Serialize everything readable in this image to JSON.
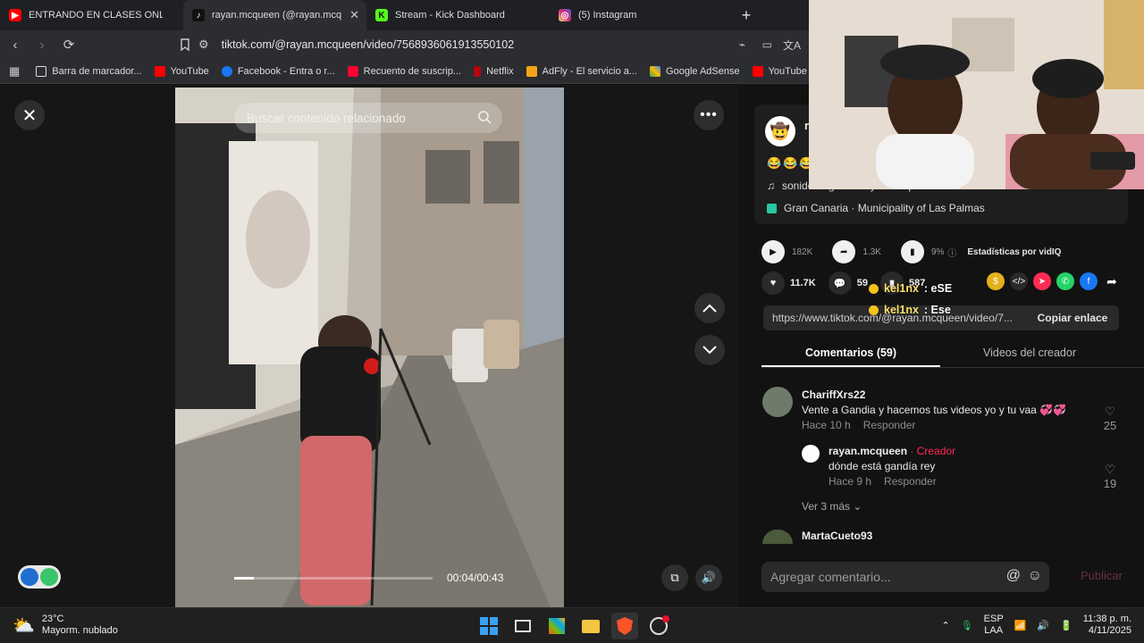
{
  "tabs": [
    {
      "label": "ENTRANDO EN CLASES ONLINE DE I",
      "icon": "youtube-icon",
      "color": "#ff0000",
      "active": false
    },
    {
      "label": "rayan.mcqueen (@rayan.mcq",
      "icon": "tiktok-icon",
      "color": "#111111",
      "active": true
    },
    {
      "label": "Stream - Kick Dashboard",
      "icon": "kick-icon",
      "color": "#53fc18",
      "active": false
    },
    {
      "label": "(5) Instagram",
      "icon": "instagram-icon",
      "color": "#d62976",
      "active": false
    }
  ],
  "address": {
    "url": "tiktok.com/@rayan.mcqueen/video/7568936061913550102"
  },
  "bookmarks": [
    {
      "label": "Barra de marcador...",
      "icon": "folder-icon",
      "color": "#dddddd"
    },
    {
      "label": "YouTube",
      "icon": "youtube-icon",
      "color": "#ff0000"
    },
    {
      "label": "Facebook - Entra o r...",
      "icon": "facebook-icon",
      "color": "#1877f2"
    },
    {
      "label": "Recuento de suscrip...",
      "icon": "youtube-icon",
      "color": "#ff0033"
    },
    {
      "label": "Netflix",
      "icon": "netflix-icon",
      "color": "#b20710"
    },
    {
      "label": "AdFly - El servicio a...",
      "icon": "adfly-icon",
      "color": "#f2a516"
    },
    {
      "label": "Google AdSense",
      "icon": "adsense-icon",
      "color": "#fbbc04"
    },
    {
      "label": "YouTube Creator St...",
      "icon": "youtube-icon",
      "color": "#ff0000"
    }
  ],
  "video": {
    "search_placeholder": "Buscar contenido relacionado",
    "time": "00:04/00:43",
    "progress": 0.1
  },
  "side": {
    "avatar_initial": "r",
    "emojis": "😂😂😂",
    "sound": "sonido original - rayan.mcqueen",
    "location": "Gran Canaria · Municipality of Las Palmas",
    "stats": {
      "plays": "182K",
      "shares": "1.3K",
      "percent": "9%",
      "vidiq_label": "Estadísticas por vidIQ"
    },
    "actions": {
      "likes": "11.7K",
      "comments": "59",
      "saves": "587"
    },
    "link": "https://www.tiktok.com/@rayan.mcqueen/video/7...",
    "copy_label": "Copiar enlace",
    "tab_comments": "Comentarios (59)",
    "tab_creator_videos": "Videos del creador"
  },
  "comments": [
    {
      "user": "ChariffXrs22",
      "text": "Vente a Gandia y hacemos tus videos yo y tu vaa 💞💞",
      "time": "Hace 10 h",
      "reply": "Responder",
      "likes": "25"
    },
    {
      "user": "rayan.mcqueen",
      "creator_tag": " · Creador",
      "text": "dónde está gandía rey",
      "time": "Hace 9 h",
      "reply": "Responder",
      "likes": "19"
    },
    {
      "user": "MartaCueto93"
    }
  ],
  "view_more": "Ver 3 más",
  "comment_input": {
    "placeholder": "Agregar comentario...",
    "publish": "Publicar"
  },
  "chat_overlay": [
    {
      "user": "kel1nx",
      "message": ": eSE"
    },
    {
      "user": "kel1nx",
      "message": ": Ese"
    }
  ],
  "taskbar": {
    "temperature": "23°C",
    "weather": "Mayorm. nublado",
    "lang": "ESP",
    "layout": "LAA",
    "time": "11:38 p. m.",
    "date": "4/11/2025"
  }
}
